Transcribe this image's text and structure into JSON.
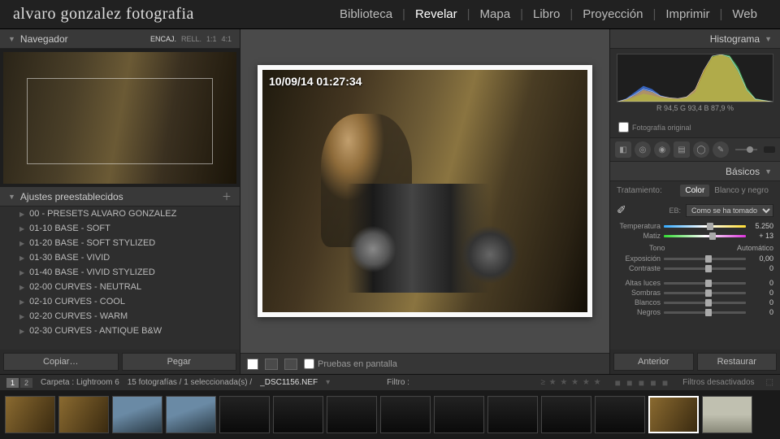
{
  "identity": "alvaro gonzalez fotografia",
  "nav": {
    "items": [
      "Biblioteca",
      "Revelar",
      "Mapa",
      "Libro",
      "Proyección",
      "Imprimir",
      "Web"
    ],
    "active": "Revelar"
  },
  "left": {
    "navigator": {
      "title": "Navegador",
      "modes": [
        "ENCAJ.",
        "RELL.",
        "1:1",
        "4:1"
      ]
    },
    "presets": {
      "title": "Ajustes preestablecidos",
      "items": [
        "00 - PRESETS ALVARO GONZALEZ",
        "01-10 BASE - SOFT",
        "01-20 BASE - SOFT STYLIZED",
        "01-30 BASE - VIVID",
        "01-40 BASE - VIVID STYLIZED",
        "02-00 CURVES - NEUTRAL",
        "02-10 CURVES - COOL",
        "02-20 CURVES - WARM",
        "02-30 CURVES - ANTIQUE B&W"
      ]
    },
    "buttons": {
      "copy": "Copiar…",
      "paste": "Pegar"
    }
  },
  "center": {
    "timestamp": "10/09/14 01:27:34",
    "softproof": "Pruebas en pantalla"
  },
  "right": {
    "histogram": {
      "title": "Histograma",
      "readout": "R  94,5   G  93,4   B  87,9  %",
      "original": "Fotografía original"
    },
    "basics": {
      "title": "Básicos",
      "treatment": {
        "label": "Tratamiento:",
        "color": "Color",
        "bw": "Blanco y negro"
      },
      "wb": {
        "label": "EB:",
        "preset": "Como se ha tomado"
      },
      "temp": {
        "label": "Temperatura",
        "value": "5.250",
        "pos": 52
      },
      "tint": {
        "label": "Matiz",
        "value": "+ 13",
        "pos": 55
      },
      "tone_head": "Tono",
      "auto": "Automático",
      "exposure": {
        "label": "Exposición",
        "value": "0,00",
        "pos": 50
      },
      "contrast": {
        "label": "Contraste",
        "value": "0",
        "pos": 50
      },
      "highlights": {
        "label": "Altas luces",
        "value": "0",
        "pos": 50
      },
      "shadows": {
        "label": "Sombras",
        "value": "0",
        "pos": 50
      },
      "whites": {
        "label": "Blancos",
        "value": "0",
        "pos": 50
      },
      "blacks": {
        "label": "Negros",
        "value": "0",
        "pos": 50
      }
    },
    "buttons": {
      "prev": "Anterior",
      "reset": "Restaurar"
    }
  },
  "status": {
    "pages": [
      "1",
      "2"
    ],
    "folder": "Carpeta : Lightroom 6",
    "count": "15 fotografías / 1 seleccionada(s) /",
    "file": "_DSC1156.NEF",
    "filter_label": "Filtro :",
    "filters_off": "Filtros desactivados"
  },
  "chart_data": {
    "type": "area",
    "title": "Histograma",
    "xlabel": "",
    "ylabel": "",
    "xlim": [
      0,
      255
    ],
    "ylim": [
      0,
      100
    ],
    "series": [
      {
        "name": "R",
        "color": "#ff5040",
        "values": [
          0,
          2,
          6,
          12,
          10,
          6,
          4,
          3,
          4,
          8,
          20,
          48,
          80,
          95,
          70,
          30,
          8,
          0
        ]
      },
      {
        "name": "G",
        "color": "#40d040",
        "values": [
          0,
          1,
          3,
          6,
          7,
          5,
          4,
          3,
          4,
          10,
          26,
          55,
          85,
          98,
          72,
          28,
          6,
          0
        ]
      },
      {
        "name": "B",
        "color": "#4080ff",
        "values": [
          0,
          4,
          10,
          18,
          16,
          10,
          6,
          4,
          5,
          12,
          30,
          58,
          82,
          90,
          60,
          20,
          4,
          0
        ]
      }
    ],
    "readout": {
      "R": 94.5,
      "G": 93.4,
      "B": 87.9
    }
  }
}
